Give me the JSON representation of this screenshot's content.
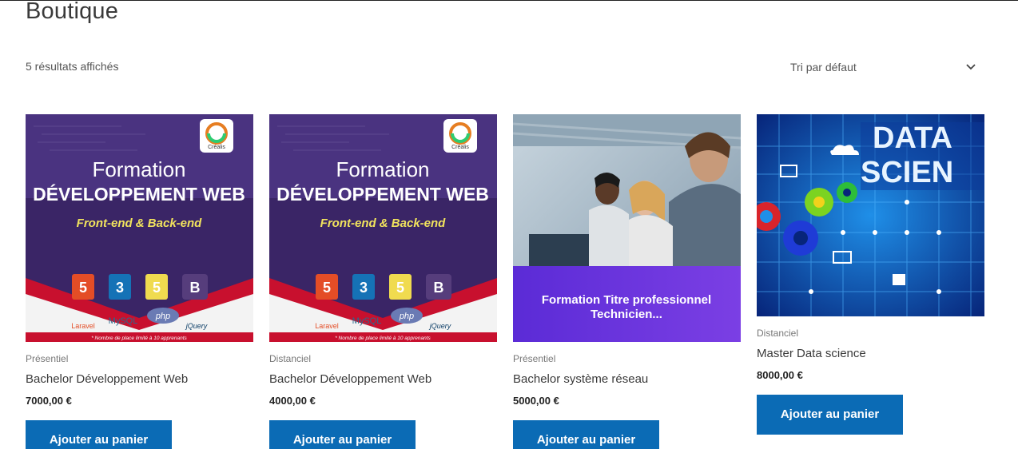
{
  "page": {
    "title": "Boutique",
    "result_count": "5 résultats affichés"
  },
  "sort": {
    "selected": "Tri par défaut"
  },
  "brand": {
    "accent": "#0b6bb5"
  },
  "thumb_text": {
    "logo": "Créalis",
    "formation": "Formation",
    "dev_web": "DÉVELOPPEMENT WEB",
    "front_back": "Front-end & Back-end",
    "footnote": "* Nombre de place limité à 10 apprenants",
    "laravel": "Laravel",
    "mysql": "MySQL",
    "php": "php",
    "jquery": "jQuery",
    "tp_line1": "Formation Titre professionnel",
    "tp_line2": "Technicien...",
    "data_line1": "DATA",
    "data_line2": "SCIEN"
  },
  "products": [
    {
      "category": "Présentiel",
      "title": "Bachelor Développement Web",
      "price": "7000,00 €",
      "button": "Ajouter au panier"
    },
    {
      "category": "Distanciel",
      "title": "Bachelor Développement Web",
      "price": "4000,00 €",
      "button": "Ajouter au panier"
    },
    {
      "category": "Présentiel",
      "title": "Bachelor système réseau",
      "price": "5000,00 €",
      "button": "Ajouter au panier"
    },
    {
      "category": "Distanciel",
      "title": "Master Data science",
      "price": "8000,00 €",
      "button": "Ajouter au panier"
    }
  ]
}
